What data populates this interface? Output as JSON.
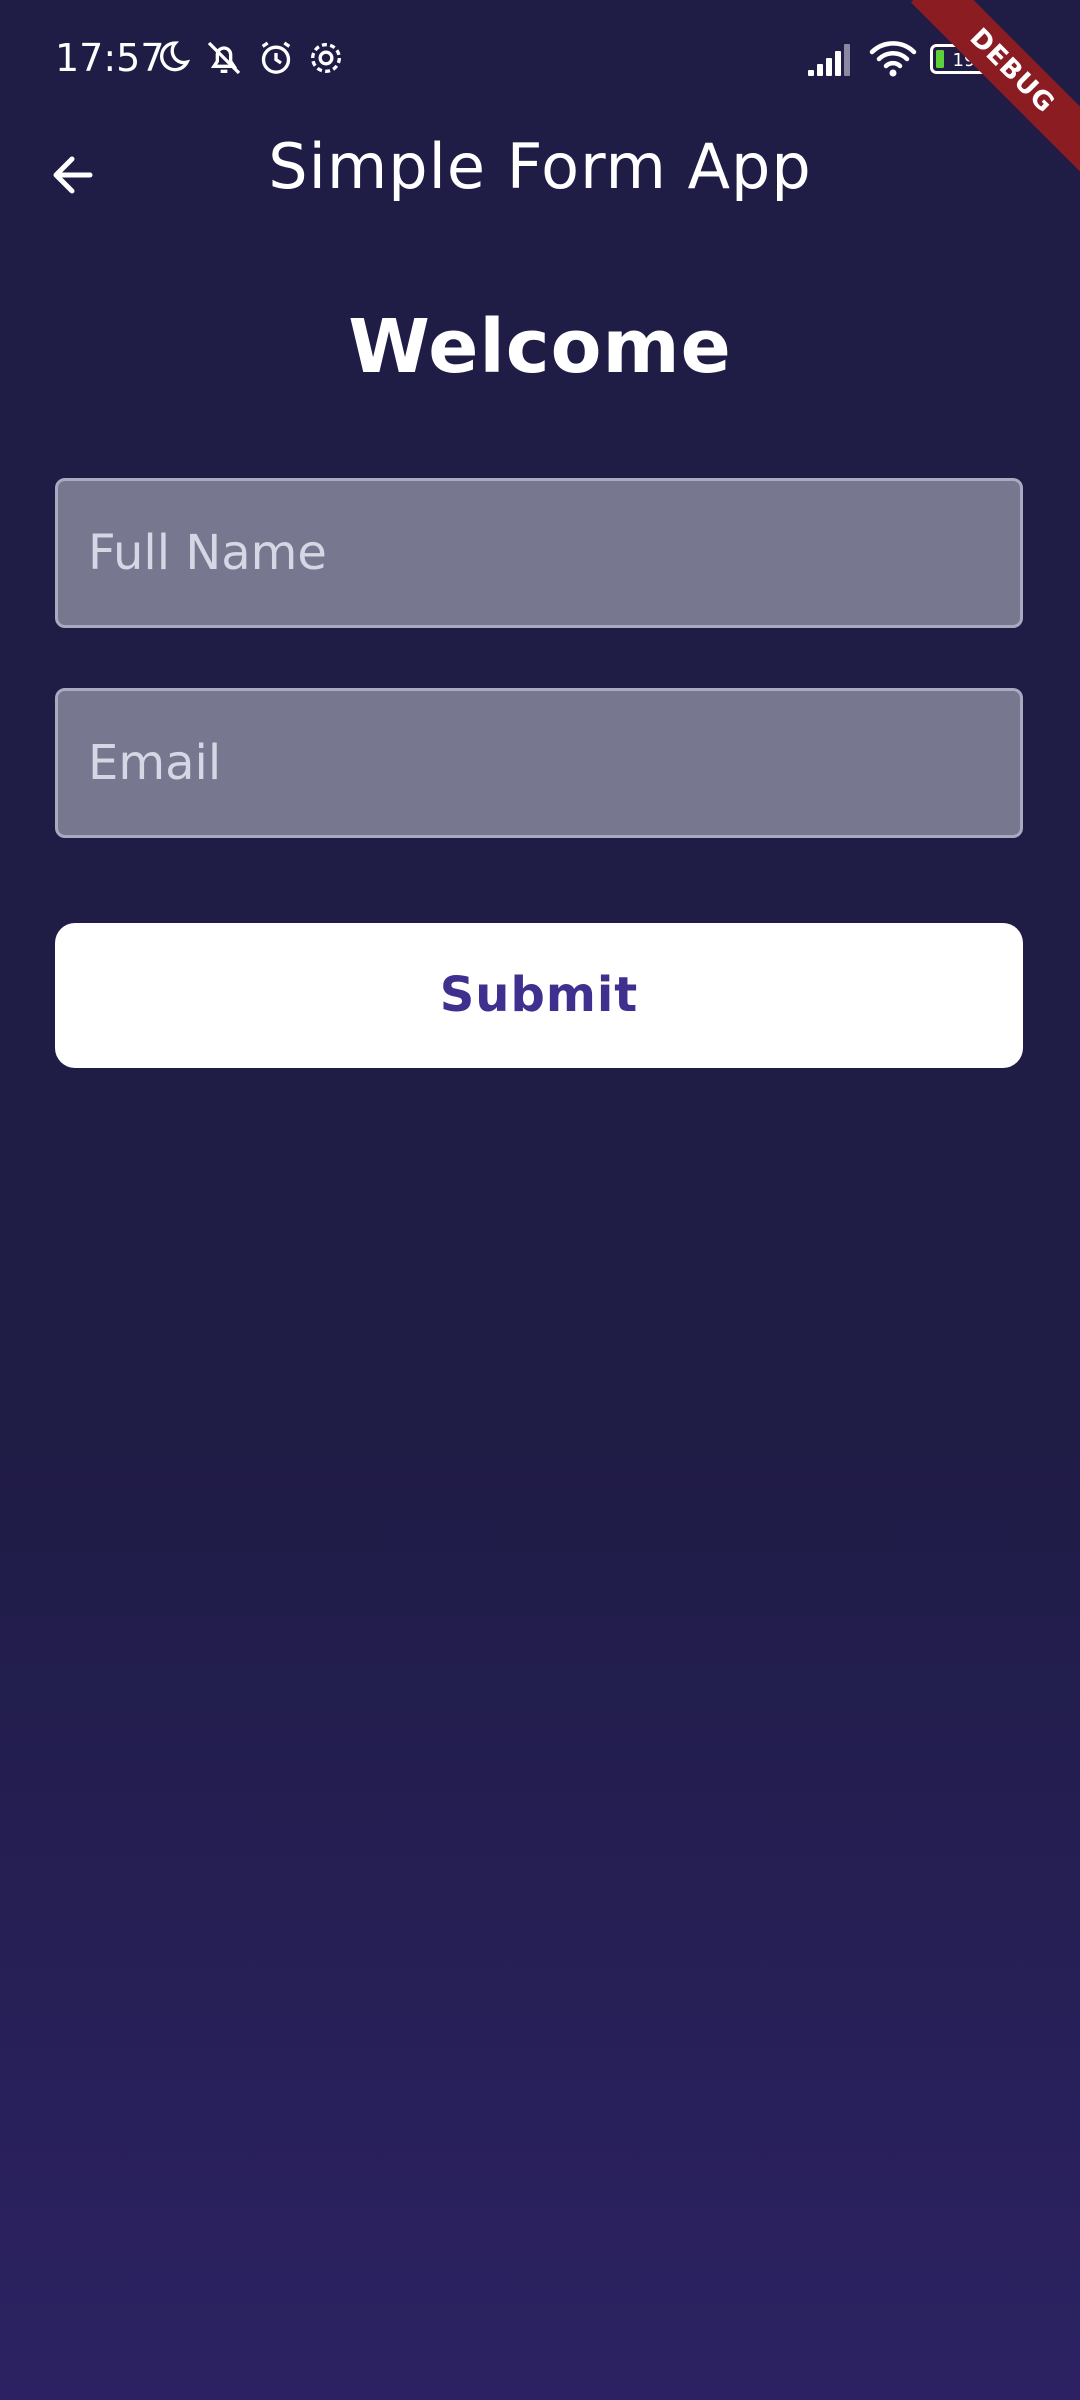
{
  "status_bar": {
    "time": "17:57",
    "battery_level": "19",
    "icons": [
      "moon-icon",
      "bell-off-icon",
      "alarm-icon",
      "settings-icon",
      "signal-icon",
      "wifi-icon",
      "battery-icon"
    ]
  },
  "debug_banner": {
    "label": "DEBUG",
    "color": "#8b1c22"
  },
  "app_bar": {
    "title": "Simple Form App",
    "back_icon": "arrow-left-icon"
  },
  "form": {
    "heading": "Welcome",
    "full_name": {
      "placeholder": "Full Name",
      "value": ""
    },
    "email": {
      "placeholder": "Email",
      "value": ""
    },
    "submit_label": "Submit"
  },
  "colors": {
    "background_top": "#1f1c46",
    "background_bottom": "#2c2263",
    "field_fill": "#777890",
    "submit_text": "#3f2f8e"
  }
}
